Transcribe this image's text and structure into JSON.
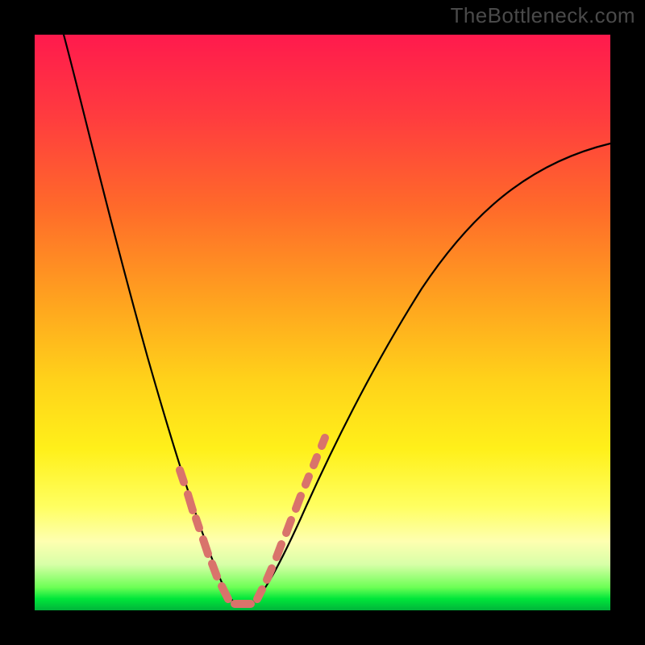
{
  "watermark": "TheBottleneck.com",
  "chart_data": {
    "type": "line",
    "title": "",
    "xlabel": "",
    "ylabel": "",
    "xlim": [
      0,
      100
    ],
    "ylim": [
      0,
      100
    ],
    "series": [
      {
        "name": "bottleneck-curve",
        "x": [
          5,
          10,
          15,
          20,
          25,
          29,
          32,
          35,
          38,
          45,
          52,
          60,
          68,
          76,
          84,
          92,
          100
        ],
        "y": [
          100,
          75,
          53,
          35,
          20,
          9,
          3,
          0,
          3,
          14,
          28,
          42,
          54,
          63,
          70,
          75,
          79
        ]
      }
    ],
    "highlight_segments": {
      "left": {
        "x_start": 25.5,
        "x_end": 30.5
      },
      "right": {
        "x_start": 38.0,
        "x_end": 46.5
      }
    },
    "background_gradient": {
      "stops": [
        {
          "pos": 0.0,
          "color": "#ff1a4d"
        },
        {
          "pos": 0.3,
          "color": "#ff6a2a"
        },
        {
          "pos": 0.6,
          "color": "#ffd21a"
        },
        {
          "pos": 0.82,
          "color": "#ffff61"
        },
        {
          "pos": 0.96,
          "color": "#6dff55"
        },
        {
          "pos": 1.0,
          "color": "#00b43a"
        }
      ]
    }
  }
}
